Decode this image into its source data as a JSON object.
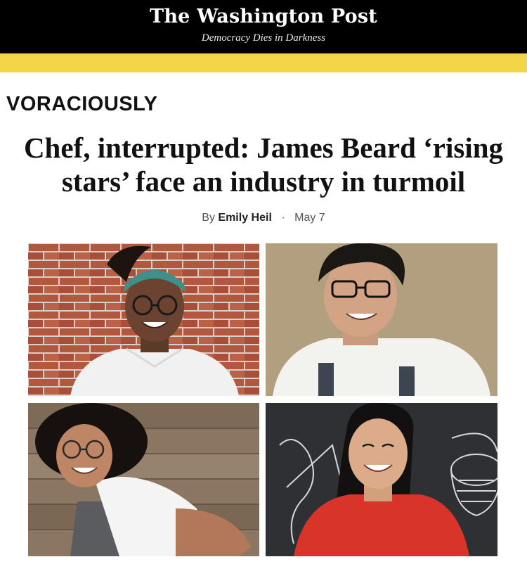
{
  "masthead": {
    "logo": "The Washington Post",
    "tagline": "Democracy Dies in Darkness"
  },
  "section": {
    "label": "VORACIOUSLY"
  },
  "article": {
    "headline_line1": "Chef, interrupted: James Beard ‘rising",
    "headline_line2": "stars’ face an industry in turmoil",
    "byline_prefix": "By",
    "author": "Emily Heil",
    "separator": "·",
    "date": "May 7"
  },
  "colors": {
    "masthead_bg": "#000000",
    "accent_bar": "#f3d54a",
    "text": "#111111"
  },
  "photos": [
    {
      "name": "chef-photo-brick-wall"
    },
    {
      "name": "chef-photo-plaster-wall"
    },
    {
      "name": "chef-photo-wood-wall"
    },
    {
      "name": "chef-photo-chalkboard"
    }
  ]
}
